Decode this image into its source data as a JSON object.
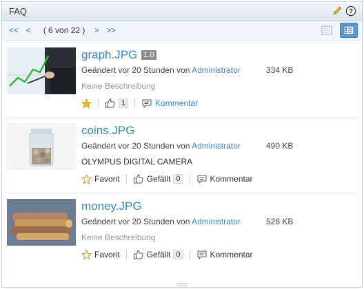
{
  "portlet": {
    "title": "FAQ",
    "icons": {
      "edit": "pencil-icon",
      "help": "help-icon"
    }
  },
  "toolbar": {
    "first": "<<",
    "prev": "<",
    "counter": "( 6 von 22 )",
    "next": ">",
    "last": ">>",
    "view_grid": "grid-view-icon",
    "view_list": "list-view-icon"
  },
  "items": [
    {
      "name": "graph.JPG",
      "version": "1.0",
      "modified": "Geändert vor 20 Stunden von",
      "author": "Administrator",
      "size": "334 KB",
      "description": "Keine Beschreibung",
      "fav_label": "",
      "like_label": "",
      "like_count": "1",
      "comment_label": "Kommentar"
    },
    {
      "name": "coins.JPG",
      "version": "",
      "modified": "Geändert vor 20 Stunden von",
      "author": "Administrator",
      "size": "490 KB",
      "description": "OLYMPUS DIGITAL CAMERA",
      "fav_label": "Favorit",
      "like_label": "Gefällt",
      "like_count": "0",
      "comment_label": "Kommentar"
    },
    {
      "name": "money.JPG",
      "version": "",
      "modified": "Geändert vor 20 Stunden von",
      "author": "Administrator",
      "size": "528 KB",
      "description": "Keine Beschreibung",
      "fav_label": "Favorit",
      "like_label": "Gefällt",
      "like_count": "0",
      "comment_label": "Kommentar"
    }
  ],
  "colors": {
    "link": "#3a86c8",
    "star_active": "#f3c21b"
  }
}
